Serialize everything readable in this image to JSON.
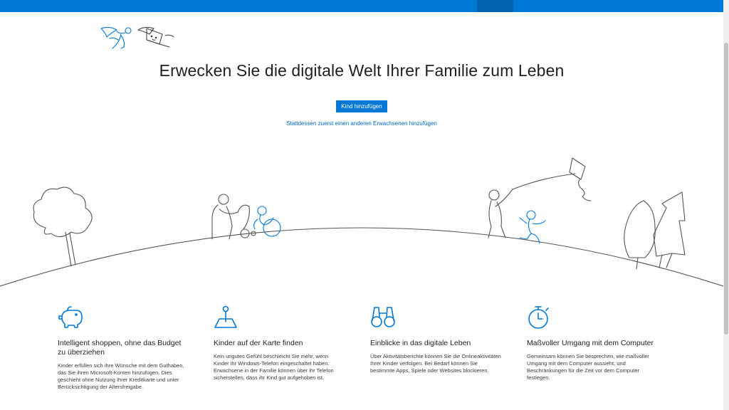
{
  "hero": {
    "title": "Erwecken Sie die digitale Welt Ihrer Familie zum Leben",
    "add_child_label": "Kind hinzufügen",
    "add_adult_link": "Stattdessen zuerst einen anderen Erwachsenen hinzufügen"
  },
  "features": [
    {
      "icon": "piggy-bank-icon",
      "title": "Intelligent shoppen, ohne das Budget zu überziehen",
      "text": "Kinder erfüllen sich ihre Wünsche mit dem Guthaben, das Sie ihren Microsoft-Konten hinzufügen. Dies geschieht ohne Nutzung Ihrer Kreditkarte und unter Berücksichtigung der Altersfreigabe."
    },
    {
      "icon": "map-pin-icon",
      "title": "Kinder auf der Karte finden",
      "text": "Kein ungutes Gefühl beschleicht Sie mehr, wenn Kinder ihr Windows-Telefon eingeschaltet haben. Erwachsene in der Familie können über ihr Telefon sicherstellen, dass ihr Kind gut aufgehoben ist."
    },
    {
      "icon": "binoculars-icon",
      "title": "Einblicke in das digitale Leben",
      "text": "Über Aktivitätsberichte können Sie die Onlineaktivitäten Ihrer Kinder verfolgen. Bei Bedarf können Sie bestimmte Apps, Spiele oder Websites blockieren."
    },
    {
      "icon": "stopwatch-icon",
      "title": "Maßvoller Umgang mit dem Computer",
      "text": "Gemeinsam können Sie besprechen, wie maßvoller Umgang mit dem Computer aussieht, und Beschränkungen für die Zeit vor dem Computer festlegen."
    }
  ],
  "colors": {
    "accent": "#0078d7",
    "link": "#0067b8",
    "line_art": "#555555"
  }
}
